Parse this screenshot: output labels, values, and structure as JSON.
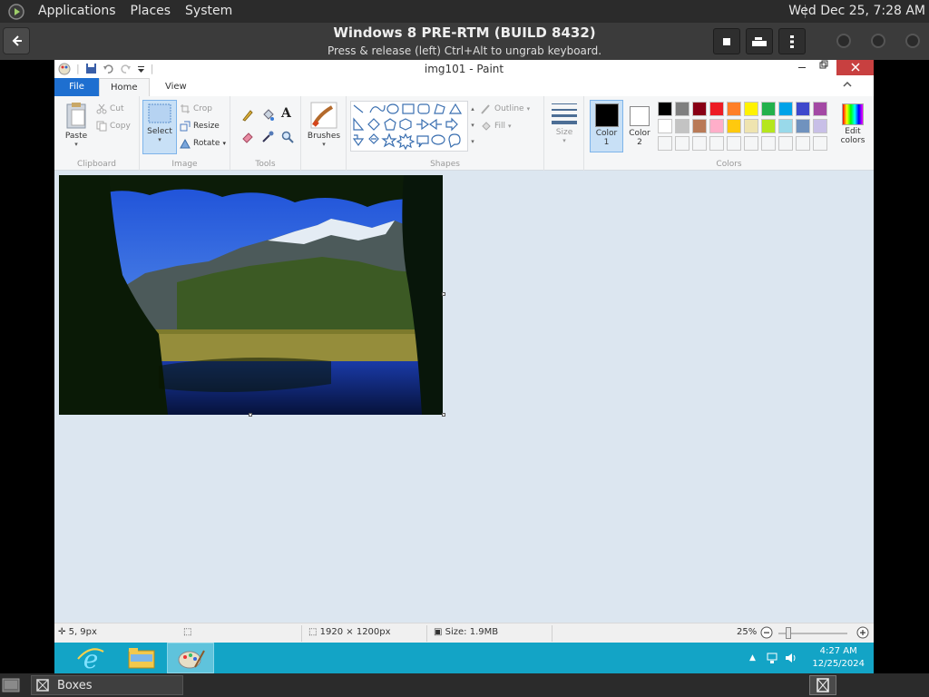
{
  "gnome_panel": {
    "menus": [
      "Applications",
      "Places",
      "System"
    ],
    "clock": "Wed Dec 25,  7:28 AM"
  },
  "boxes": {
    "title": "Windows 8 PRE-RTM (BUILD 8432)",
    "subtitle": "Press & release (left) Ctrl+Alt to ungrab keyboard."
  },
  "paint": {
    "window_title": "img101 - Paint",
    "tabs": {
      "file": "File",
      "home": "Home",
      "view": "View"
    },
    "clipboard": {
      "paste": "Paste",
      "cut": "Cut",
      "copy": "Copy",
      "group": "Clipboard"
    },
    "image": {
      "select": "Select",
      "crop": "Crop",
      "resize": "Resize",
      "rotate": "Rotate",
      "group": "Image"
    },
    "tools": {
      "group": "Tools"
    },
    "brushes": {
      "label": "Brushes"
    },
    "shapes": {
      "outline": "Outline",
      "fill": "Fill",
      "group": "Shapes"
    },
    "size": {
      "label": "Size"
    },
    "colors": {
      "color1_line1": "Color",
      "color1_line2": "1",
      "color2_line1": "Color",
      "color2_line2": "2",
      "edit_line1": "Edit",
      "edit_line2": "colors",
      "group": "Colors",
      "palette_row1": [
        "#000000",
        "#7f7f7f",
        "#880015",
        "#ed1c24",
        "#ff7f27",
        "#fff200",
        "#22b14c",
        "#00a2e8",
        "#3f48cc",
        "#a349a4"
      ],
      "palette_row2": [
        "#ffffff",
        "#c3c3c3",
        "#b97a57",
        "#ffaec9",
        "#ffc90e",
        "#efe4b0",
        "#b5e61d",
        "#99d9ea",
        "#7092be",
        "#c8bfe7"
      ]
    },
    "status": {
      "cursor_pos": "5, 9px",
      "image_dims": "1920 × 1200px",
      "file_size": "Size: 1.9MB",
      "zoom": "25%"
    }
  },
  "taskbar": {
    "time": "4:27 AM",
    "date": "12/25/2024"
  },
  "gnome_bottom": {
    "task_label": "Boxes"
  }
}
